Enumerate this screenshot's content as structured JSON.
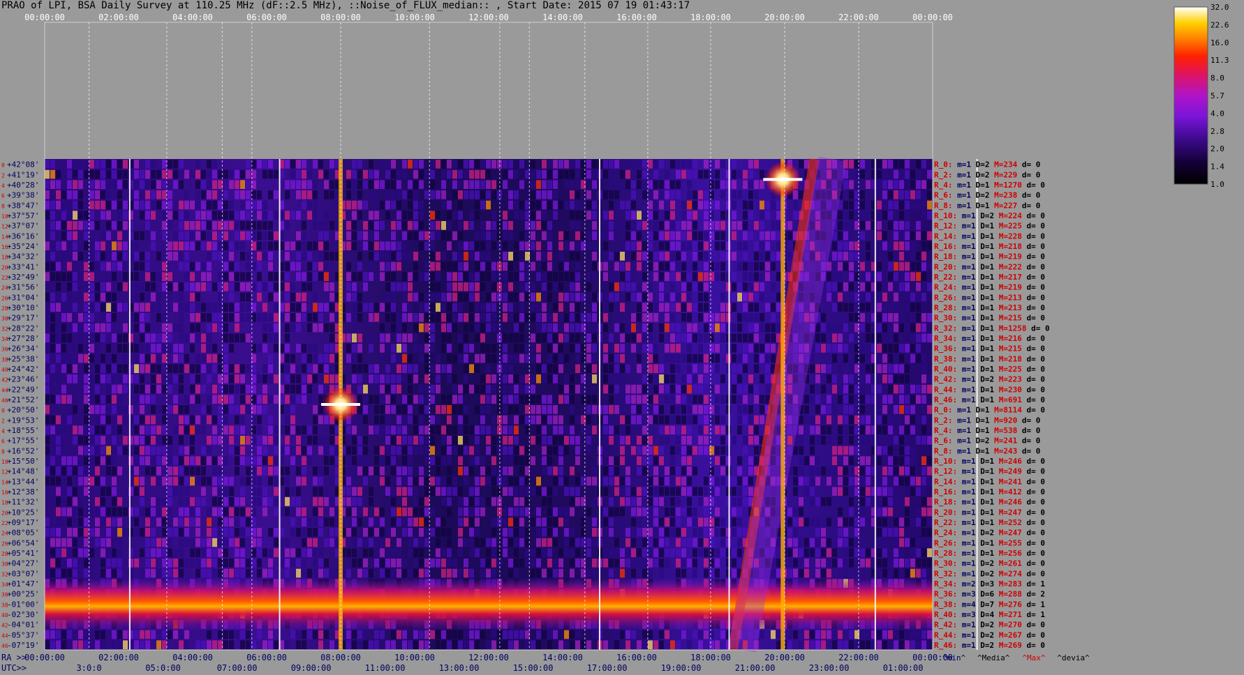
{
  "title": "PRAO of LPI, BSA Daily Survey at 110.25 MHz (dF::2.5 MHz), ::Noise_of_FLUX_median:: , Start Date: 2015 07 19 01:43:17",
  "colors": {
    "background": "#9a9a9a",
    "dec_label": "#000060",
    "index_label": "#d00000",
    "stat_name": "#d00000",
    "stat_m": "#000060",
    "stat_D": "#000000",
    "stat_M": "#d00000",
    "stat_d": "#000000"
  },
  "chart_data": {
    "type": "heatmap",
    "top_axis_labels": [
      "00:00:00",
      "02:00:00",
      "04:00:00",
      "06:00:00",
      "08:00:00",
      "10:00:00",
      "12:00:00",
      "14:00:00",
      "16:00:00",
      "18:00:00",
      "20:00:00",
      "22:00:00",
      "00:00:00"
    ],
    "ra_label": "RA >>",
    "ra_axis_labels": [
      "00:00:00",
      "02:00:00",
      "04:00:00",
      "06:00:00",
      "08:00:00",
      "10:00:00",
      "12:00:00",
      "14:00:00",
      "16:00:00",
      "18:00:00",
      "20:00:00",
      "22:00:00",
      "00:00:00"
    ],
    "utc_label": "UTC>>",
    "utc_axis_labels": [
      "3:0:0",
      "05:0:00",
      "07:00:00",
      "09:00:00",
      "11:00:00",
      "13:00:00",
      "15:00:00",
      "17:00:00",
      "19:00:00",
      "21:00:00",
      "23:00:00",
      "01:00:00"
    ],
    "y_labels": [
      "+42°08'",
      "+41°19'",
      "+40°28'",
      "+39°38'",
      "+38°47'",
      "+37°57'",
      "+37°07'",
      "+36°16'",
      "+35°24'",
      "+34°32'",
      "+33°41'",
      "+32°49'",
      "+31°56'",
      "+31°04'",
      "+30°10'",
      "+29°17'",
      "+28°22'",
      "+27°28'",
      "+26°34'",
      "+25°38'",
      "+24°42'",
      "+23°46'",
      "+22°49'",
      "+21°52'",
      "+20°50'",
      "+19°53'",
      "+18°55'",
      "+17°55'",
      "+16°52'",
      "+15°50'",
      "+14°48'",
      "+13°44'",
      "+12°38'",
      "+11°32'",
      "+10°25'",
      "+09°17'",
      "+08°05'",
      "+06°54'",
      "+05°41'",
      "+04°27'",
      "+03°07'",
      "+01°47'",
      "+00°25'",
      "-01°00'",
      "-02°30'",
      "-04°01'",
      "-05°37'",
      "-07°19'"
    ],
    "row_indices": [
      "0",
      "2",
      "4",
      "6",
      "8",
      "10",
      "12",
      "14",
      "16",
      "18",
      "20",
      "22",
      "24",
      "26",
      "28",
      "30",
      "32",
      "34",
      "36",
      "38",
      "40",
      "42",
      "44",
      "46",
      "0",
      "2",
      "4",
      "6",
      "8",
      "10",
      "12",
      "14",
      "16",
      "18",
      "20",
      "22",
      "24",
      "26",
      "28",
      "30",
      "32",
      "34",
      "36",
      "38",
      "40",
      "42",
      "44",
      "46"
    ],
    "colorbar": {
      "ticks": [
        "32.0",
        "22.6",
        "16.0",
        "11.3",
        "8.0",
        "5.7",
        "4.0",
        "2.8",
        "2.0",
        "1.4",
        "1.0"
      ],
      "range": [
        1.0,
        32.0
      ],
      "scale": "log"
    },
    "beam_stats": [
      {
        "name": "R_0:",
        "m": "m=1",
        "D": "D=2",
        "M": "M=234",
        "d": "d= 0"
      },
      {
        "name": "R_2:",
        "m": "m=1",
        "D": "D=2",
        "M": "M=229",
        "d": "d= 0"
      },
      {
        "name": "R_4:",
        "m": "m=1",
        "D": "D=1",
        "M": "M=1270",
        "d": "d= 0"
      },
      {
        "name": "R_6:",
        "m": "m=1",
        "D": "D=2",
        "M": "M=238",
        "d": "d= 0"
      },
      {
        "name": "R_8:",
        "m": "m=1",
        "D": "D=1",
        "M": "M=227",
        "d": "d= 0"
      },
      {
        "name": "R_10:",
        "m": "m=1",
        "D": "D=2",
        "M": "M=224",
        "d": "d= 0"
      },
      {
        "name": "R_12:",
        "m": "m=1",
        "D": "D=1",
        "M": "M=225",
        "d": "d= 0"
      },
      {
        "name": "R_14:",
        "m": "m=1",
        "D": "D=1",
        "M": "M=228",
        "d": "d= 0"
      },
      {
        "name": "R_16:",
        "m": "m=1",
        "D": "D=1",
        "M": "M=218",
        "d": "d= 0"
      },
      {
        "name": "R_18:",
        "m": "m=1",
        "D": "D=1",
        "M": "M=219",
        "d": "d= 0"
      },
      {
        "name": "R_20:",
        "m": "m=1",
        "D": "D=1",
        "M": "M=222",
        "d": "d= 0"
      },
      {
        "name": "R_22:",
        "m": "m=1",
        "D": "D=1",
        "M": "M=217",
        "d": "d= 0"
      },
      {
        "name": "R_24:",
        "m": "m=1",
        "D": "D=1",
        "M": "M=219",
        "d": "d= 0"
      },
      {
        "name": "R_26:",
        "m": "m=1",
        "D": "D=1",
        "M": "M=213",
        "d": "d= 0"
      },
      {
        "name": "R_28:",
        "m": "m=1",
        "D": "D=1",
        "M": "M=213",
        "d": "d= 0"
      },
      {
        "name": "R_30:",
        "m": "m=1",
        "D": "D=1",
        "M": "M=215",
        "d": "d= 0"
      },
      {
        "name": "R_32:",
        "m": "m=1",
        "D": "D=1",
        "M": "M=1258",
        "d": "d= 0"
      },
      {
        "name": "R_34:",
        "m": "m=1",
        "D": "D=1",
        "M": "M=216",
        "d": "d= 0"
      },
      {
        "name": "R_36:",
        "m": "m=1",
        "D": "D=1",
        "M": "M=215",
        "d": "d= 0"
      },
      {
        "name": "R_38:",
        "m": "m=1",
        "D": "D=1",
        "M": "M=218",
        "d": "d= 0"
      },
      {
        "name": "R_40:",
        "m": "m=1",
        "D": "D=1",
        "M": "M=225",
        "d": "d= 0"
      },
      {
        "name": "R_42:",
        "m": "m=1",
        "D": "D=2",
        "M": "M=223",
        "d": "d= 0"
      },
      {
        "name": "R_44:",
        "m": "m=1",
        "D": "D=1",
        "M": "M=230",
        "d": "d= 0"
      },
      {
        "name": "R_46:",
        "m": "m=1",
        "D": "D=1",
        "M": "M=691",
        "d": "d= 0"
      },
      {
        "name": "R_0:",
        "m": "m=1",
        "D": "D=1",
        "M": "M=8114",
        "d": "d= 0"
      },
      {
        "name": "R_2:",
        "m": "m=1",
        "D": "D=1",
        "M": "M=920",
        "d": "d= 0"
      },
      {
        "name": "R_4:",
        "m": "m=1",
        "D": "D=1",
        "M": "M=538",
        "d": "d= 0"
      },
      {
        "name": "R_6:",
        "m": "m=1",
        "D": "D=2",
        "M": "M=241",
        "d": "d= 0"
      },
      {
        "name": "R_8:",
        "m": "m=1",
        "D": "D=1",
        "M": "M=243",
        "d": "d= 0"
      },
      {
        "name": "R_10:",
        "m": "m=1",
        "D": "D=1",
        "M": "M=246",
        "d": "d= 0"
      },
      {
        "name": "R_12:",
        "m": "m=1",
        "D": "D=1",
        "M": "M=249",
        "d": "d= 0"
      },
      {
        "name": "R_14:",
        "m": "m=1",
        "D": "D=1",
        "M": "M=241",
        "d": "d= 0"
      },
      {
        "name": "R_16:",
        "m": "m=1",
        "D": "D=1",
        "M": "M=412",
        "d": "d= 0"
      },
      {
        "name": "R_18:",
        "m": "m=1",
        "D": "D=1",
        "M": "M=246",
        "d": "d= 0"
      },
      {
        "name": "R_20:",
        "m": "m=1",
        "D": "D=1",
        "M": "M=247",
        "d": "d= 0"
      },
      {
        "name": "R_22:",
        "m": "m=1",
        "D": "D=1",
        "M": "M=252",
        "d": "d= 0"
      },
      {
        "name": "R_24:",
        "m": "m=1",
        "D": "D=2",
        "M": "M=247",
        "d": "d= 0"
      },
      {
        "name": "R_26:",
        "m": "m=1",
        "D": "D=1",
        "M": "M=255",
        "d": "d= 0"
      },
      {
        "name": "R_28:",
        "m": "m=1",
        "D": "D=1",
        "M": "M=256",
        "d": "d= 0"
      },
      {
        "name": "R_30:",
        "m": "m=1",
        "D": "D=2",
        "M": "M=261",
        "d": "d= 0"
      },
      {
        "name": "R_32:",
        "m": "m=1",
        "D": "D=2",
        "M": "M=274",
        "d": "d= 0"
      },
      {
        "name": "R_34:",
        "m": "m=2",
        "D": "D=3",
        "M": "M=283",
        "d": "d= 1"
      },
      {
        "name": "R_36:",
        "m": "m=3",
        "D": "D=6",
        "M": "M=288",
        "d": "d= 2"
      },
      {
        "name": "R_38:",
        "m": "m=4",
        "D": "D=7",
        "M": "M=276",
        "d": "d= 1"
      },
      {
        "name": "R_40:",
        "m": "m=3",
        "D": "D=4",
        "M": "M=271",
        "d": "d= 1"
      },
      {
        "name": "R_42:",
        "m": "m=1",
        "D": "D=2",
        "M": "M=270",
        "d": "d= 0"
      },
      {
        "name": "R_44:",
        "m": "m=1",
        "D": "D=2",
        "M": "M=267",
        "d": "d= 0"
      },
      {
        "name": "R_46:",
        "m": "m=1",
        "D": "D=2",
        "M": "M=269",
        "d": "d= 0"
      }
    ],
    "stats_footer": [
      {
        "text": "^min^",
        "color": "#000060"
      },
      {
        "text": "^Media^",
        "color": "#000000"
      },
      {
        "text": "^Max^",
        "color": "#d00000"
      },
      {
        "text": "^devia^",
        "color": "#000000"
      }
    ],
    "features": {
      "solid_column_hours": [
        2.3,
        6.35,
        15.0,
        18.5,
        22.45,
        25.2
      ],
      "dashed_column_hours": [
        1.2,
        3.3,
        4.8,
        5.6,
        8.0,
        10.4,
        12.3,
        13.1,
        14.6,
        16.3,
        18.0,
        20.0,
        22.0,
        24.0
      ],
      "bright_source_hours": [
        8.0,
        19.95
      ],
      "horizontal_band_dec_rows": [
        41,
        46
      ],
      "drift_track": {
        "start_hour": 18.6,
        "end_hour": 20.8
      }
    }
  }
}
